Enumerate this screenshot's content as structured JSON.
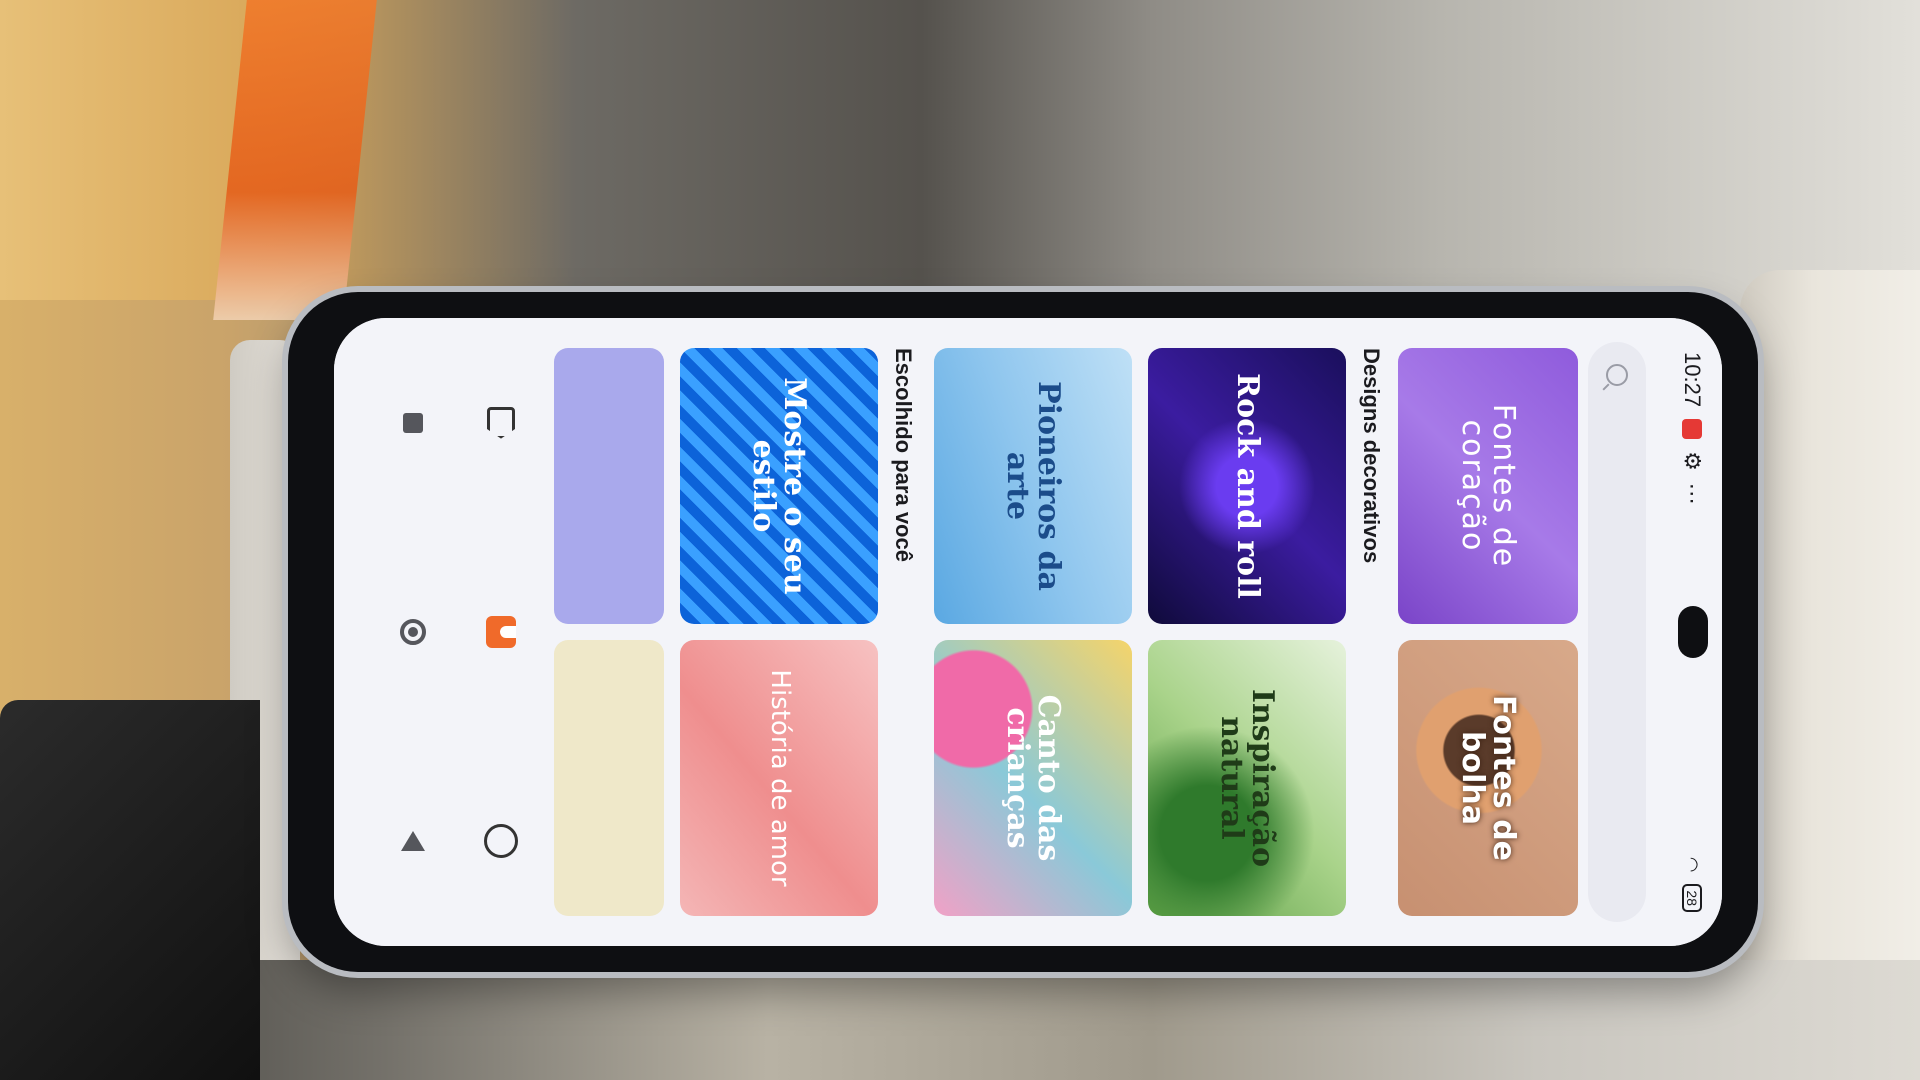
{
  "status_bar": {
    "time": "10:27",
    "battery": "28"
  },
  "search": {
    "placeholder": ""
  },
  "top_cards": [
    {
      "title": "Fontes de coração"
    },
    {
      "title": "Fontes de bolha"
    }
  ],
  "sections": [
    {
      "title": "Designs decorativos",
      "cards": [
        {
          "title": "Rock and roll"
        },
        {
          "title": "Inspiração natural"
        },
        {
          "title": "Pioneiros da arte"
        },
        {
          "title": "Canto das crianças"
        }
      ]
    },
    {
      "title": "Escolhido para você",
      "cards": [
        {
          "title": "Mostre o seu estilo"
        },
        {
          "title": "História de amor"
        }
      ]
    }
  ],
  "colors": {
    "accent": "#f06a2a",
    "screen_bg": "#f3f4f9"
  },
  "icons": {
    "nav": [
      "tag-icon",
      "themes-icon",
      "profile-icon"
    ],
    "system": [
      "recents-icon",
      "home-icon",
      "back-icon"
    ]
  }
}
